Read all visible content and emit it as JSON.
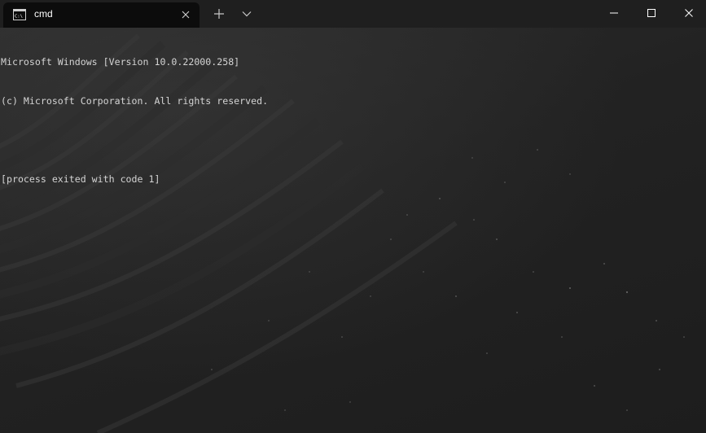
{
  "tab": {
    "title": "cmd",
    "icon": "cmd-prompt-icon"
  },
  "tabbar": {
    "new_tab_icon": "plus-icon",
    "dropdown_icon": "chevron-down-icon"
  },
  "window_controls": {
    "minimize_icon": "minimize-icon",
    "maximize_icon": "maximize-icon",
    "close_icon": "close-icon"
  },
  "console": {
    "lines": [
      "Microsoft Windows [Version 10.0.22000.258]",
      "(c) Microsoft Corporation. All rights reserved.",
      "",
      "[process exited with code 1]"
    ]
  },
  "colors": {
    "titlebar": "#1f1f1f",
    "active_tab": "#0c0c0c",
    "text": "#d4d4d4",
    "terminal_background": "#222222"
  }
}
